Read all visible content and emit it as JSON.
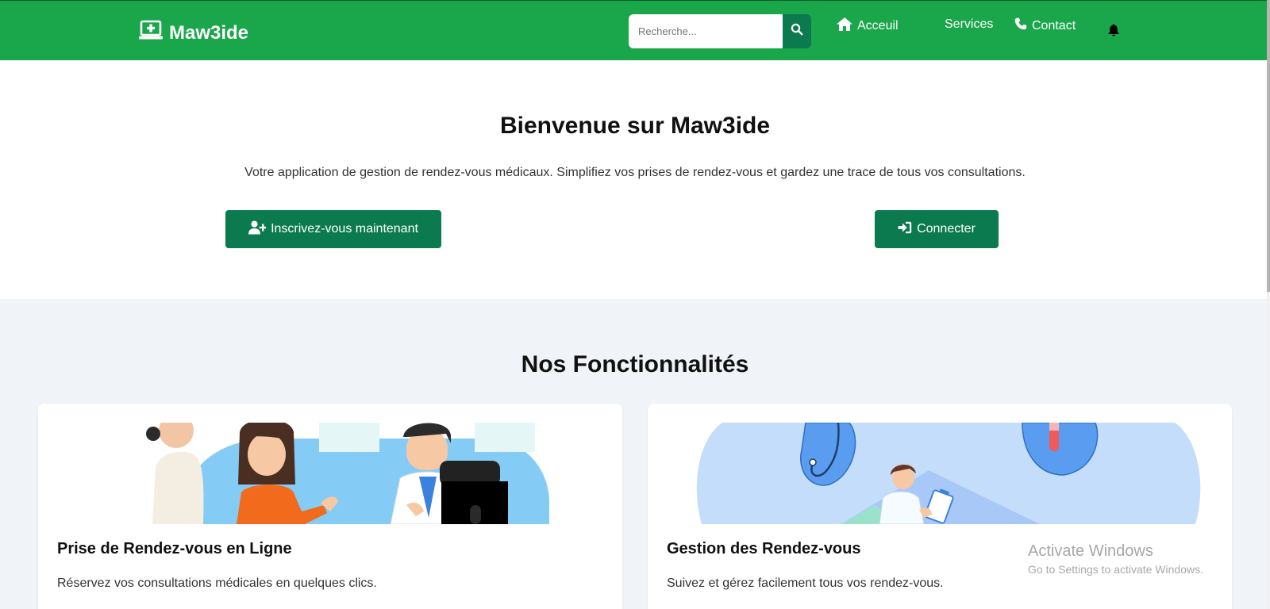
{
  "navbar": {
    "brand": "Maw3ide",
    "search_placeholder": "Recherche...",
    "links": {
      "home": "Acceuil",
      "services": "Services",
      "contact": "Contact"
    }
  },
  "hero": {
    "title": "Bienvenue sur Maw3ide",
    "description": "Votre application de gestion de rendez-vous médicaux. Simplifiez vos prises de rendez-vous et gardez une trace de tous vos consultations.",
    "register_label": "Inscrivez-vous maintenant",
    "login_label": "Connecter"
  },
  "features": {
    "title": "Nos Fonctionnalités",
    "cards": [
      {
        "title": "Prise de Rendez-vous en Ligne",
        "description": "Réservez vos consultations médicales en quelques clics."
      },
      {
        "title": "Gestion des Rendez-vous",
        "description": "Suivez et gérez facilement tous vos rendez-vous."
      }
    ]
  },
  "watermark": {
    "title": "Activate Windows",
    "subtitle": "Go to Settings to activate Windows."
  },
  "colors": {
    "navbar": "#1aa64b",
    "accent": "#0b7a4f",
    "features_bg": "#f0f3f7"
  },
  "icons": [
    "medical-laptop-icon",
    "search-icon",
    "home-icon",
    "phone-icon",
    "bell-icon",
    "user-plus-icon",
    "sign-in-icon"
  ]
}
